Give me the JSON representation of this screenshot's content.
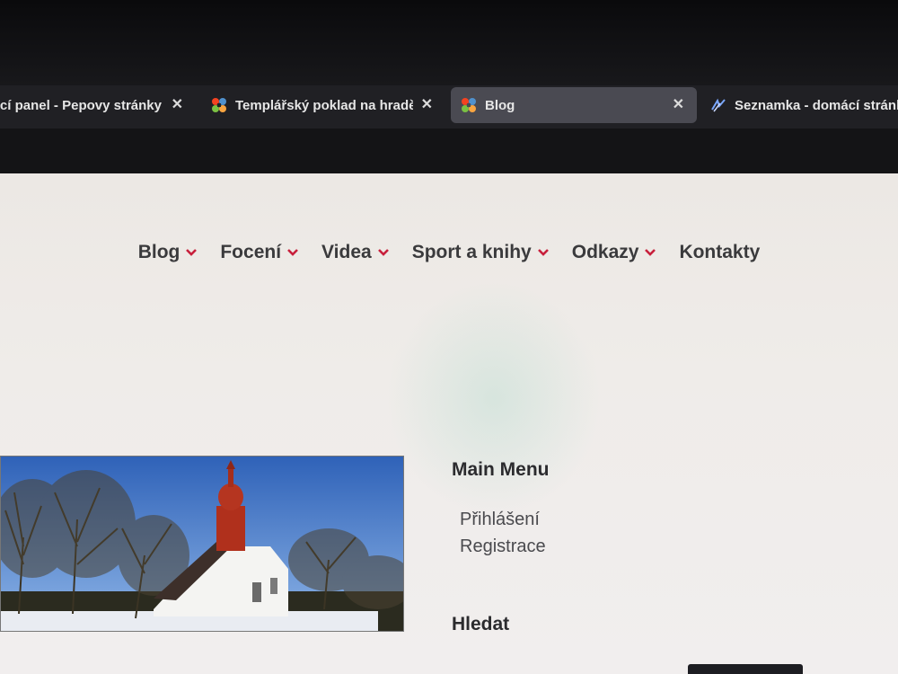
{
  "browser": {
    "tabs": [
      {
        "label": "Ovládací panel - Pepovy stránky",
        "favicon": "none",
        "active": false
      },
      {
        "label": "Templářský poklad na hradě Veveří",
        "favicon": "joomla-icon",
        "active": false
      },
      {
        "label": "Blog",
        "favicon": "joomla-icon",
        "active": true
      },
      {
        "label": "Seznamka - domácí stránka",
        "favicon": "seznamka-icon",
        "active": false
      }
    ],
    "close_glyph": "✕"
  },
  "site": {
    "nav": [
      {
        "label": "Blog",
        "has_dropdown": true
      },
      {
        "label": "Focení",
        "has_dropdown": true
      },
      {
        "label": "Videa",
        "has_dropdown": true
      },
      {
        "label": "Sport a knihy",
        "has_dropdown": true
      },
      {
        "label": "Odkazy",
        "has_dropdown": true
      },
      {
        "label": "Kontakty",
        "has_dropdown": false
      }
    ],
    "main_menu": {
      "title": "Main Menu",
      "items": [
        "Přihlášení",
        "Registrace"
      ]
    },
    "search": {
      "title": "Hledat"
    },
    "accent_color": "#c8203c"
  }
}
